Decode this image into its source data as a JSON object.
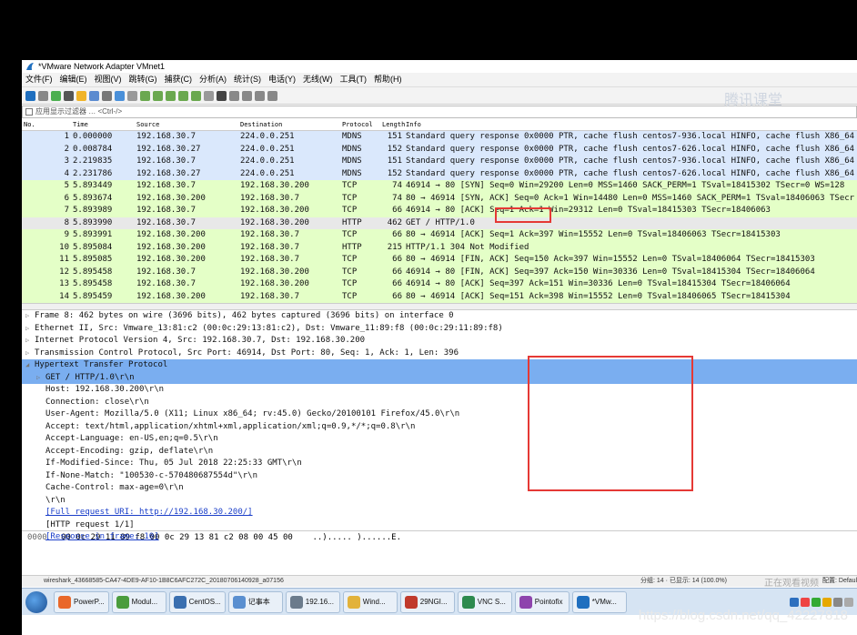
{
  "window": {
    "title": "*VMware Network Adapter VMnet1"
  },
  "menu": [
    "文件(F)",
    "编辑(E)",
    "视图(V)",
    "跳转(G)",
    "捕获(C)",
    "分析(A)",
    "统计(S)",
    "电话(Y)",
    "无线(W)",
    "工具(T)",
    "帮助(H)"
  ],
  "filter": {
    "placeholder": "应用显示过滤器 … <Ctrl-/>"
  },
  "columns": {
    "no": "No.",
    "time": "Time",
    "source": "Source",
    "destination": "Destination",
    "protocol": "Protocol",
    "length": "Length",
    "info": "Info"
  },
  "packets": [
    {
      "no": "1",
      "time": "0.000000",
      "src": "192.168.30.7",
      "dst": "224.0.0.251",
      "proto": "MDNS",
      "len": "151",
      "info": "Standard query response 0x0000 PTR, cache flush centos7-936.local HINFO, cache flush X86_64"
    },
    {
      "no": "2",
      "time": "0.008784",
      "src": "192.168.30.27",
      "dst": "224.0.0.251",
      "proto": "MDNS",
      "len": "152",
      "info": "Standard query response 0x0000 PTR, cache flush centos7-626.local HINFO, cache flush X86_64"
    },
    {
      "no": "3",
      "time": "2.219835",
      "src": "192.168.30.7",
      "dst": "224.0.0.251",
      "proto": "MDNS",
      "len": "151",
      "info": "Standard query response 0x0000 PTR, cache flush centos7-936.local HINFO, cache flush X86_64"
    },
    {
      "no": "4",
      "time": "2.231786",
      "src": "192.168.30.27",
      "dst": "224.0.0.251",
      "proto": "MDNS",
      "len": "152",
      "info": "Standard query response 0x0000 PTR, cache flush centos7-626.local HINFO, cache flush X86_64"
    },
    {
      "no": "5",
      "time": "5.893449",
      "src": "192.168.30.7",
      "dst": "192.168.30.200",
      "proto": "TCP",
      "len": "74",
      "info": "46914 → 80 [SYN] Seq=0 Win=29200 Len=0 MSS=1460 SACK_PERM=1 TSval=18415302 TSecr=0 WS=128"
    },
    {
      "no": "6",
      "time": "5.893674",
      "src": "192.168.30.200",
      "dst": "192.168.30.7",
      "proto": "TCP",
      "len": "74",
      "info": "80 → 46914 [SYN, ACK] Seq=0 Ack=1 Win=14480 Len=0 MSS=1460 SACK_PERM=1 TSval=18406063 TSecr"
    },
    {
      "no": "7",
      "time": "5.893989",
      "src": "192.168.30.7",
      "dst": "192.168.30.200",
      "proto": "TCP",
      "len": "66",
      "info": "46914 → 80 [ACK] Seq=1 Ack=1 Win=29312 Len=0 TSval=18415303 TSecr=18406063"
    },
    {
      "no": "8",
      "time": "5.893990",
      "src": "192.168.30.7",
      "dst": "192.168.30.200",
      "proto": "HTTP",
      "len": "462",
      "info": "GET / HTTP/1.0"
    },
    {
      "no": "9",
      "time": "5.893991",
      "src": "192.168.30.200",
      "dst": "192.168.30.7",
      "proto": "TCP",
      "len": "66",
      "info": "80 → 46914 [ACK] Seq=1 Ack=397 Win=15552 Len=0 TSval=18406063 TSecr=18415303"
    },
    {
      "no": "10",
      "time": "5.895084",
      "src": "192.168.30.200",
      "dst": "192.168.30.7",
      "proto": "HTTP",
      "len": "215",
      "info": "HTTP/1.1 304 Not Modified"
    },
    {
      "no": "11",
      "time": "5.895085",
      "src": "192.168.30.200",
      "dst": "192.168.30.7",
      "proto": "TCP",
      "len": "66",
      "info": "80 → 46914 [FIN, ACK] Seq=150 Ack=397 Win=15552 Len=0 TSval=18406064 TSecr=18415303"
    },
    {
      "no": "12",
      "time": "5.895458",
      "src": "192.168.30.7",
      "dst": "192.168.30.200",
      "proto": "TCP",
      "len": "66",
      "info": "46914 → 80 [FIN, ACK] Seq=397 Ack=150 Win=30336 Len=0 TSval=18415304 TSecr=18406064"
    },
    {
      "no": "13",
      "time": "5.895458",
      "src": "192.168.30.7",
      "dst": "192.168.30.200",
      "proto": "TCP",
      "len": "66",
      "info": "46914 → 80 [ACK] Seq=397 Ack=151 Win=30336 Len=0 TSval=18415304 TSecr=18406064"
    },
    {
      "no": "14",
      "time": "5.895459",
      "src": "192.168.30.200",
      "dst": "192.168.30.7",
      "proto": "TCP",
      "len": "66",
      "info": "80 → 46914 [ACK] Seq=151 Ack=398 Win=15552 Len=0 TSval=18406065 TSecr=18415304"
    }
  ],
  "details": [
    {
      "text": "Frame 8: 462 bytes on wire (3696 bits), 462 bytes captured (3696 bits) on interface 0",
      "level": 0,
      "arrow": "▷"
    },
    {
      "text": "Ethernet II, Src: Vmware_13:81:c2 (00:0c:29:13:81:c2), Dst: Vmware_11:89:f8 (00:0c:29:11:89:f8)",
      "level": 0,
      "arrow": "▷"
    },
    {
      "text": "Internet Protocol Version 4, Src: 192.168.30.7, Dst: 192.168.30.200",
      "level": 0,
      "arrow": "▷"
    },
    {
      "text": "Transmission Control Protocol, Src Port: 46914, Dst Port: 80, Seq: 1, Ack: 1, Len: 396",
      "level": 0,
      "arrow": "▷"
    },
    {
      "text": "Hypertext Transfer Protocol",
      "level": 0,
      "arrow": "◢",
      "selected": true
    },
    {
      "text": "GET / HTTP/1.0\\r\\n",
      "level": 1,
      "arrow": "▷",
      "selected": true
    },
    {
      "text": "Host: 192.168.30.200\\r\\n",
      "level": 1,
      "arrow": ""
    },
    {
      "text": "Connection: close\\r\\n",
      "level": 1,
      "arrow": ""
    },
    {
      "text": "User-Agent: Mozilla/5.0 (X11; Linux x86_64; rv:45.0) Gecko/20100101 Firefox/45.0\\r\\n",
      "level": 1,
      "arrow": ""
    },
    {
      "text": "Accept: text/html,application/xhtml+xml,application/xml;q=0.9,*/*;q=0.8\\r\\n",
      "level": 1,
      "arrow": ""
    },
    {
      "text": "Accept-Language: en-US,en;q=0.5\\r\\n",
      "level": 1,
      "arrow": ""
    },
    {
      "text": "Accept-Encoding: gzip, deflate\\r\\n",
      "level": 1,
      "arrow": ""
    },
    {
      "text": "If-Modified-Since: Thu, 05 Jul 2018 22:25:33 GMT\\r\\n",
      "level": 1,
      "arrow": ""
    },
    {
      "text": "If-None-Match: \"100530-c-570480687554d\"\\r\\n",
      "level": 1,
      "arrow": ""
    },
    {
      "text": "Cache-Control: max-age=0\\r\\n",
      "level": 1,
      "arrow": ""
    },
    {
      "text": "\\r\\n",
      "level": 1,
      "arrow": ""
    },
    {
      "text": "[Full request URI: http://192.168.30.200/]",
      "level": 1,
      "arrow": "",
      "link": true
    },
    {
      "text": "[HTTP request 1/1]",
      "level": 1,
      "arrow": ""
    },
    {
      "text": "[Response in frame: 10]",
      "level": 1,
      "arrow": "",
      "link": true
    }
  ],
  "hex": {
    "offset": "0000",
    "bytes": "00 0c 29 11 89 f8 00 0c  29 13 81 c2 08 00 45 00",
    "ascii": "..)..... )......E."
  },
  "status": {
    "file": "wireshark_43668585-CA47-4DE9-AF10-1B8C6AFC272C_20180706140928_a07156",
    "packets": "分组: 14 · 已显示: 14 (100.0%)",
    "profile": "配置: Default"
  },
  "taskbar": [
    {
      "label": "PowerP...",
      "color": "#e9682a"
    },
    {
      "label": "Modul...",
      "color": "#4a9c3d"
    },
    {
      "label": "CentOS...",
      "color": "#3a6fb0"
    },
    {
      "label": "记事本",
      "color": "#5a8fd0"
    },
    {
      "label": "192.16...",
      "color": "#6b7b8c"
    },
    {
      "label": "Wind...",
      "color": "#e2b23a"
    },
    {
      "label": "29NGI...",
      "color": "#c0392b"
    },
    {
      "label": "VNC S...",
      "color": "#2d8a4e"
    },
    {
      "label": "Pointofix",
      "color": "#8e44ad"
    },
    {
      "label": "*VMw...",
      "color": "#1f6fbf"
    }
  ],
  "overlays": {
    "brand": "腾讯课堂",
    "playback": "正在观看视频",
    "watermark": "https://blog.csdn.net/qq_42227818"
  }
}
